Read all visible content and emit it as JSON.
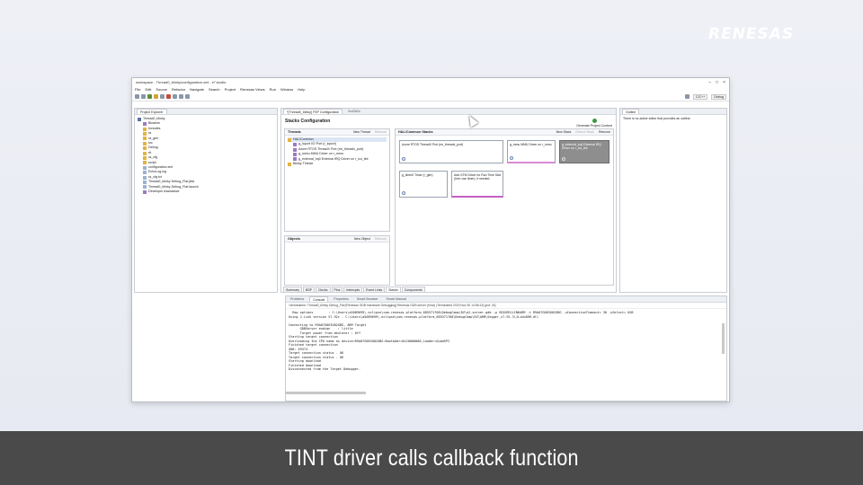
{
  "brand": {
    "logo_text": "RENESAS"
  },
  "caption": "TINT driver calls callback function",
  "window": {
    "title": "workspace - Thread0_blinky/configuration.xml - e² studio",
    "menu": [
      "File",
      "Edit",
      "Source",
      "Refactor",
      "Navigate",
      "Search",
      "Project",
      "Renesas Views",
      "Run",
      "Window",
      "Help"
    ],
    "perspective": "C/C++",
    "debug_label": "Debug"
  },
  "project_explorer": {
    "tab": "Project Explorer",
    "items": [
      "Thread0_blinky",
      "Binaries",
      "Includes",
      "ra",
      "ra_gen",
      "src",
      "Debug",
      "rtt",
      "ra_cfg",
      "script",
      "configuration.xml",
      "EchoLog.log",
      "ra_cfg.txt",
      "Thread0_blinky Debug_Flat.jlink",
      "Thread0_blinky Debug_Flat.launch",
      "Developer Assistance"
    ]
  },
  "editor": {
    "tabs": [
      "*[Thread0_blinky] FSP Configuration",
      "0x4262c"
    ],
    "stacks_title": "Stacks Configuration",
    "generate_label": "Generate Project Content",
    "threads": {
      "header": "Threads",
      "new_thread": "New Thread",
      "remove": "Remove",
      "items": [
        "HAL/Common",
        "g_ioport I/O Port (r_ioport)",
        "Azure RTOS ThreadX Port (rm_threadx_port)",
        "g_ioimu MMU Driver on r_mmu",
        "g_external_irq0 External IRQ Driver on r_icu_tint",
        "Blinky Thread"
      ]
    },
    "objects": {
      "header": "Objects",
      "new_object": "New Object",
      "remove": "Remove"
    },
    "hal": {
      "header": "HAL/Common Stacks",
      "new_stack": "New Stack",
      "extend_stack": "Extend Stack",
      "remove": "Remove",
      "modules": [
        "Azure RTOS ThreadX Port (rm_threadx_port)",
        "g_mmu MMU Driver on r_mmu",
        "g_external_irq0 External IRQ Driver on r_icu_tint",
        "g_timer0 Timer (r_gtm)",
        "Add GTM Driver for Run Time Stat (hint: use timer), if needed"
      ]
    },
    "bottom_tabs": [
      "Summary",
      "BSP",
      "Clocks",
      "Pins",
      "Interrupts",
      "Event Links",
      "Stacks",
      "Components"
    ]
  },
  "outline": {
    "tab": "Outline",
    "message": "There is no active editor that provides an outline."
  },
  "console": {
    "tabs": [
      "Problems",
      "Console",
      "Properties",
      "Smart Browser",
      "Smart Manual"
    ],
    "terminated": "<terminated> Thread0_blinky Debug_Flat [Renesas GDB Hardware Debugging] Renesas GDB server (Host) (Terminated 2023 Nov 30 14:56:13) [pid: 24]",
    "lines": [
      "  Raw options        : C:\\Users\\a5089699\\.eclipse\\com.renesas.platform_685371768\\DebugComp\\RZ\\e2-server-gdb -g SEGGERJLINKARM -t R9A07G063U02GBG -uConnectionTimeout= 30 -uSelect= USB",
      "Using J-Link version V7.92c - C:\\Users\\a5089699\\.eclipse\\com.renesas.platform_685371768\\DebugComp\\RZ\\ARM\\Segger_v7.92.3\\JLinkARM.dll",
      "",
      "Connecting to R9A07G063U02GBG, ARM Target",
      "      GDBServer endian    : little",
      "      Target power from emulator : Off",
      "Starting target connection",
      "Overloading the CPU name as device=R9A07G063U02GBG:BootAddr=0x20000000,Loader=QuadSPI",
      "Finished target connection",
      "GDB: 59374",
      "Target connection status - OK",
      "Target connection status - OK",
      "Starting download",
      "Finished download",
      "Disconnected from the Target Debugger."
    ]
  }
}
